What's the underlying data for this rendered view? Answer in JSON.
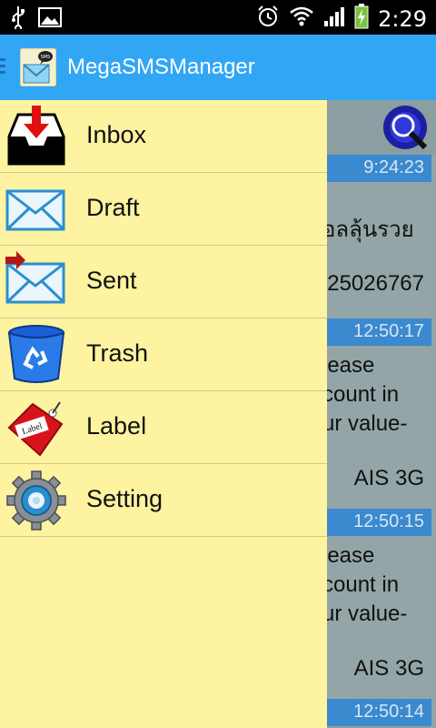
{
  "status_bar": {
    "time": "2:29",
    "icons": [
      "usb-icon",
      "image-icon",
      "alarm-icon",
      "wifi-icon",
      "signal-icon",
      "battery-charging-icon"
    ]
  },
  "action_bar": {
    "title": "MegaSMSManager",
    "color": "#31a6f5"
  },
  "drawer": {
    "background": "#fef3a0",
    "items": [
      {
        "label": "Inbox",
        "icon": "inbox-tray-icon"
      },
      {
        "label": "Draft",
        "icon": "envelope-icon"
      },
      {
        "label": "Sent",
        "icon": "sent-envelope-icon"
      },
      {
        "label": "Trash",
        "icon": "recycle-bin-icon"
      },
      {
        "label": "Label",
        "icon": "tag-label-icon",
        "icon_text": "Label"
      },
      {
        "label": "Setting",
        "icon": "gear-icon"
      }
    ]
  },
  "messages": [
    {
      "time": "9:24:23",
      "lines": [
        "อลลุ้นรวย",
        "25026767"
      ]
    },
    {
      "time": "12:50:17",
      "lines": [
        "lease",
        "count in",
        "ur value-",
        "AIS 3G"
      ]
    },
    {
      "time": "12:50:15",
      "lines": [
        "lease",
        "count in",
        "ur value-",
        "AIS 3G"
      ]
    },
    {
      "time": "12:50:14",
      "lines": []
    }
  ]
}
